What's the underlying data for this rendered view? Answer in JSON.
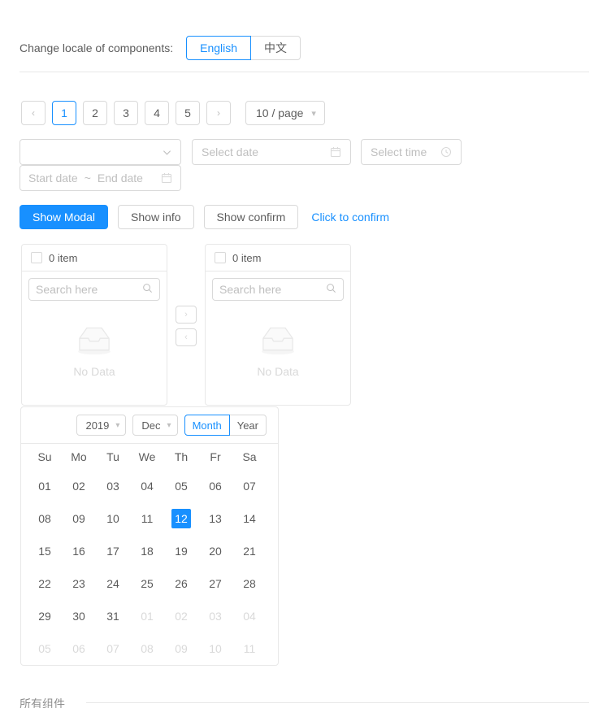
{
  "locale": {
    "label": "Change locale of components:",
    "options": [
      {
        "label": "English",
        "active": true
      },
      {
        "label": "中文",
        "active": false
      }
    ]
  },
  "pagination": {
    "prev_icon": "chevron-left-icon",
    "next_icon": "chevron-right-icon",
    "prev_label": "‹",
    "next_label": "›",
    "pages": [
      "1",
      "2",
      "3",
      "4",
      "5"
    ],
    "active_page": "1",
    "page_size_label": "10 / page",
    "page_size_icon": "chevron-down-icon"
  },
  "inputs": {
    "select_empty": {
      "value": "",
      "icon": "chevron-down-icon"
    },
    "date_picker": {
      "placeholder": "Select date",
      "icon": "calendar-icon"
    },
    "time_picker": {
      "placeholder": "Select time",
      "icon": "clock-icon"
    },
    "range_picker": {
      "start_placeholder": "Start date",
      "separator": "~",
      "end_placeholder": "End date",
      "icon": "calendar-icon"
    }
  },
  "buttons": {
    "show_modal": "Show Modal",
    "show_info": "Show info",
    "show_confirm": "Show confirm",
    "click_to_confirm": "Click to confirm"
  },
  "transfer": {
    "left": {
      "count_label": "0 item",
      "search_placeholder": "Search here",
      "search_icon": "search-icon",
      "empty_text": "No Data",
      "empty_icon": "empty-box-icon"
    },
    "right": {
      "count_label": "0 item",
      "search_placeholder": "Search here",
      "search_icon": "search-icon",
      "empty_text": "No Data",
      "empty_icon": "empty-box-icon"
    },
    "operations": {
      "to_right_label": "›",
      "to_right_icon": "chevron-right-icon",
      "to_left_label": "‹",
      "to_left_icon": "chevron-left-icon"
    }
  },
  "calendar": {
    "year": "2019",
    "year_icon": "chevron-down-icon",
    "month": "Dec",
    "month_icon": "chevron-down-icon",
    "modes": [
      {
        "label": "Month",
        "active": true
      },
      {
        "label": "Year",
        "active": false
      }
    ],
    "weekdays": [
      "Su",
      "Mo",
      "Tu",
      "We",
      "Th",
      "Fr",
      "Sa"
    ],
    "selected_day": "12",
    "weeks": [
      [
        {
          "d": "01",
          "other": false
        },
        {
          "d": "02",
          "other": false
        },
        {
          "d": "03",
          "other": false
        },
        {
          "d": "04",
          "other": false
        },
        {
          "d": "05",
          "other": false
        },
        {
          "d": "06",
          "other": false
        },
        {
          "d": "07",
          "other": false
        }
      ],
      [
        {
          "d": "08",
          "other": false
        },
        {
          "d": "09",
          "other": false
        },
        {
          "d": "10",
          "other": false
        },
        {
          "d": "11",
          "other": false
        },
        {
          "d": "12",
          "other": false,
          "selected": true
        },
        {
          "d": "13",
          "other": false
        },
        {
          "d": "14",
          "other": false
        }
      ],
      [
        {
          "d": "15",
          "other": false
        },
        {
          "d": "16",
          "other": false
        },
        {
          "d": "17",
          "other": false
        },
        {
          "d": "18",
          "other": false
        },
        {
          "d": "19",
          "other": false
        },
        {
          "d": "20",
          "other": false
        },
        {
          "d": "21",
          "other": false
        }
      ],
      [
        {
          "d": "22",
          "other": false
        },
        {
          "d": "23",
          "other": false
        },
        {
          "d": "24",
          "other": false
        },
        {
          "d": "25",
          "other": false
        },
        {
          "d": "26",
          "other": false
        },
        {
          "d": "27",
          "other": false
        },
        {
          "d": "28",
          "other": false
        }
      ],
      [
        {
          "d": "29",
          "other": false
        },
        {
          "d": "30",
          "other": false
        },
        {
          "d": "31",
          "other": false
        },
        {
          "d": "01",
          "other": true
        },
        {
          "d": "02",
          "other": true
        },
        {
          "d": "03",
          "other": true
        },
        {
          "d": "04",
          "other": true
        }
      ],
      [
        {
          "d": "05",
          "other": true
        },
        {
          "d": "06",
          "other": true
        },
        {
          "d": "07",
          "other": true
        },
        {
          "d": "08",
          "other": true
        },
        {
          "d": "09",
          "other": true
        },
        {
          "d": "10",
          "other": true
        },
        {
          "d": "11",
          "other": true
        }
      ]
    ]
  },
  "footer": {
    "text": "所有组件"
  },
  "colors": {
    "accent": "#1890ff",
    "border": "#d9d9d9",
    "divider": "#e8e8e8",
    "text": "rgba(0,0,0,0.65)",
    "muted": "#bfbfbf"
  }
}
